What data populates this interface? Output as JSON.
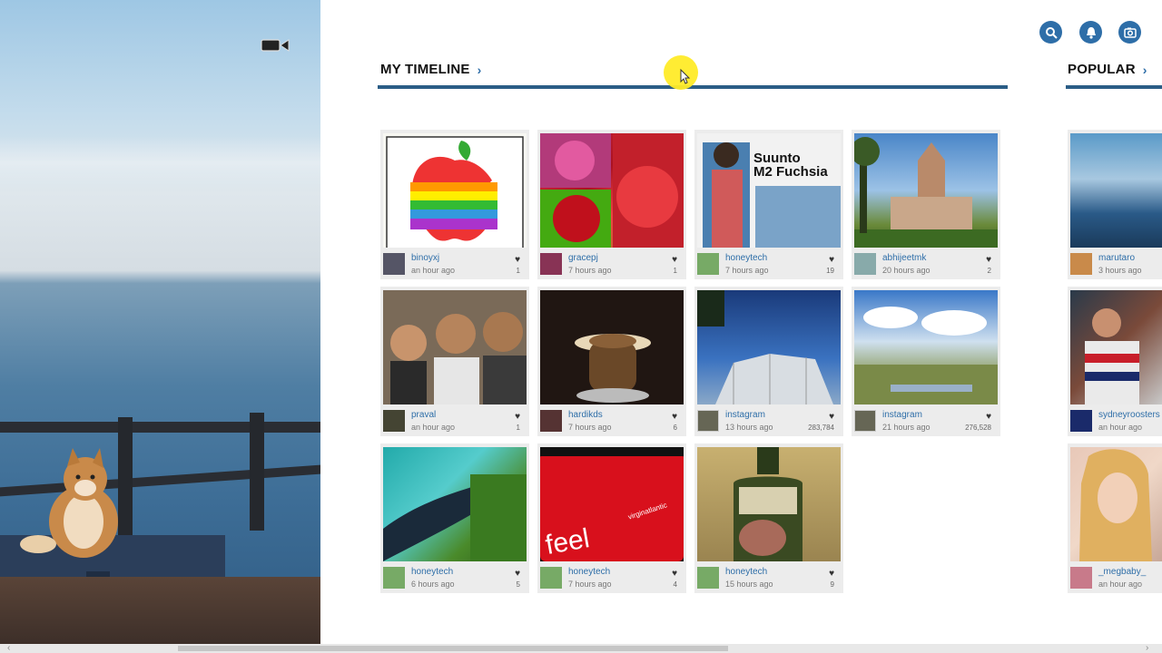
{
  "colors": {
    "accent": "#2e6ea8",
    "underline": "#2b5d86",
    "card_bg": "#ececec"
  },
  "header": {
    "icons": [
      "video-camera-icon",
      "search-icon",
      "bell-icon",
      "camera-icon"
    ]
  },
  "sections": {
    "timeline": {
      "title": "MY TIMELINE",
      "chevron": "›"
    },
    "popular": {
      "title": "POPULAR",
      "chevron": "›"
    }
  },
  "timeline_cards": [
    {
      "user": "binoyxj",
      "time": "an hour ago",
      "likes": "1"
    },
    {
      "user": "gracepj",
      "time": "7 hours ago",
      "likes": "1"
    },
    {
      "user": "honeytech",
      "time": "7 hours ago",
      "likes": "19"
    },
    {
      "user": "abhijeetmk",
      "time": "20 hours ago",
      "likes": "2"
    },
    {
      "user": "praval",
      "time": "an hour ago",
      "likes": "1"
    },
    {
      "user": "hardikds",
      "time": "7 hours ago",
      "likes": "6"
    },
    {
      "user": "instagram",
      "time": "13 hours ago",
      "likes": "283,784"
    },
    {
      "user": "instagram",
      "time": "21 hours ago",
      "likes": "276,528"
    },
    {
      "user": "honeytech",
      "time": "6 hours ago",
      "likes": "5"
    },
    {
      "user": "honeytech",
      "time": "7 hours ago",
      "likes": "4"
    },
    {
      "user": "honeytech",
      "time": "15 hours ago",
      "likes": "9"
    }
  ],
  "popular_cards": [
    {
      "user": "marutaro",
      "time": "3 hours ago"
    },
    {
      "user": "sydneyroosters",
      "time": "an hour ago"
    },
    {
      "user": "_megbaby_",
      "time": "an hour ago"
    }
  ],
  "image_texts": {
    "suunto_line1": "Suunto",
    "suunto_line2": "M2 Fuchsia",
    "feel": "feel",
    "virgin": "virginatlantic"
  },
  "scrollbar": {
    "left_arrow": "‹",
    "right_arrow": "›"
  }
}
